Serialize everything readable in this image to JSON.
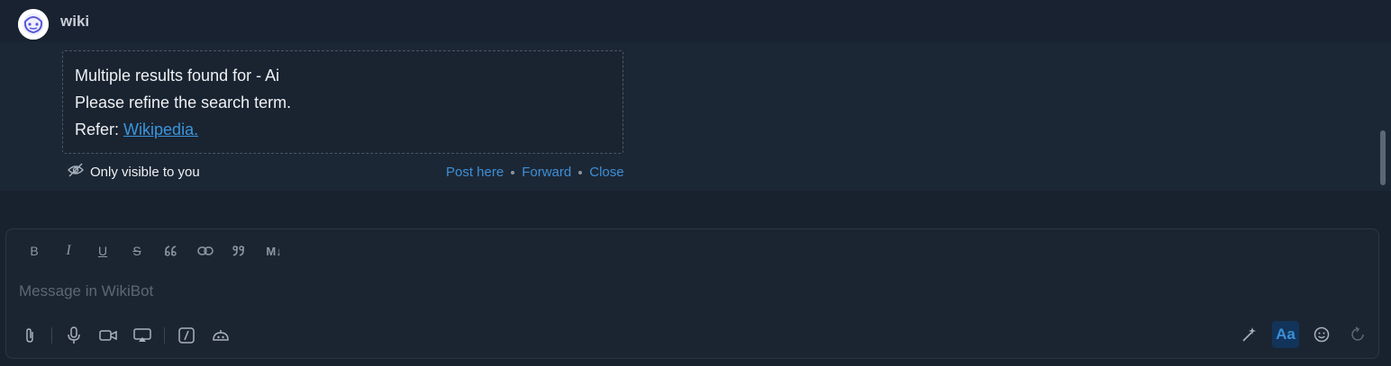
{
  "header": {
    "bot_name": "wiki",
    "avatar_icon": "bot-avatar-icon"
  },
  "message": {
    "line1": "Multiple results found for - Ai",
    "line2": "Please refine the search term.",
    "refer_prefix": "Refer:",
    "refer_link": "Wikipedia.",
    "visibility_note": "Only visible to you",
    "actions": [
      "Post here",
      "Forward",
      "Close"
    ]
  },
  "composer": {
    "placeholder": "Message in WikiBot",
    "format_tools": [
      "bold",
      "italic",
      "underline",
      "strikethrough",
      "blockquote",
      "link",
      "quote",
      "markdown"
    ],
    "format_labels": {
      "bold": "B",
      "italic": "I",
      "underline": "U",
      "strikethrough": "S",
      "markdown": "M↓"
    },
    "attach_tools": [
      "attachment-icon",
      "microphone-icon",
      "video-icon",
      "screen-share-icon",
      "slash-command-icon",
      "bot-icon"
    ],
    "right_tools": [
      "ai-magic-icon",
      "text-format-toggle",
      "emoji-icon",
      "send-icon"
    ],
    "text_format_label": "Aa"
  },
  "colors": {
    "accent": "#3d8fd6",
    "background": "#1b2531",
    "text": "#e8ebef",
    "muted": "#8e97a4"
  }
}
